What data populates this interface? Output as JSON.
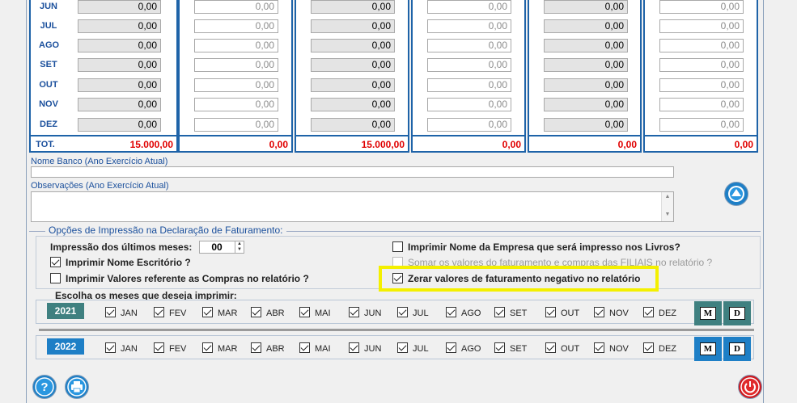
{
  "months": [
    "JUN",
    "JUL",
    "AGO",
    "SET",
    "OUT",
    "NOV",
    "DEZ"
  ],
  "total_label": "TOT.",
  "columns": [
    {
      "values": [
        "0,00",
        "0,00",
        "0,00",
        "0,00",
        "0,00",
        "0,00",
        "0,00"
      ],
      "total": "15.000,00"
    },
    {
      "values": [
        "0,00",
        "0,00",
        "0,00",
        "0,00",
        "0,00",
        "0,00",
        "0,00"
      ],
      "total": "0,00"
    },
    {
      "values": [
        "0,00",
        "0,00",
        "0,00",
        "0,00",
        "0,00",
        "0,00",
        "0,00"
      ],
      "total": "15.000,00"
    },
    {
      "values": [
        "0,00",
        "0,00",
        "0,00",
        "0,00",
        "0,00",
        "0,00",
        "0,00"
      ],
      "total": "0,00"
    },
    {
      "values": [
        "0,00",
        "0,00",
        "0,00",
        "0,00",
        "0,00",
        "0,00",
        "0,00"
      ],
      "total": "0,00"
    },
    {
      "values": [
        "0,00",
        "0,00",
        "0,00",
        "0,00",
        "0,00",
        "0,00",
        "0,00"
      ],
      "total": "0,00"
    }
  ],
  "nome_banco_label": "Nome Banco (Ano Exercício Atual)",
  "nome_banco_value": "",
  "observacoes_label": "Observações (Ano Exercício Atual)",
  "observacoes_value": "",
  "print_options": {
    "title": "Opções de Impressão na Declaração de Faturamento:",
    "ultimos_meses_label": "Impressão dos últimos meses:",
    "ultimos_meses_value": "00",
    "nome_escritorio": {
      "label": "Imprimir Nome Escritório ?",
      "checked": true
    },
    "valores_compras": {
      "label": "Imprimir Valores referente as Compras no relatório ?",
      "checked": false
    },
    "nome_empresa": {
      "label": "Imprimir Nome da Empresa que será impresso nos Livros?",
      "checked": false
    },
    "somar_filiais": {
      "label": "Somar os valores do faturamento e compras das FILIAIS no relatório ?",
      "checked": false
    },
    "zerar_negativo": {
      "label": "Zerar valores de faturamento negativo no relatório",
      "checked": true
    }
  },
  "months_section": {
    "title": "Escolha os meses que deseja imprimir:",
    "month_names": [
      "JAN",
      "FEV",
      "MAR",
      "ABR",
      "MAI",
      "JUN",
      "JUL",
      "AGO",
      "SET",
      "OUT",
      "NOV",
      "DEZ"
    ],
    "years": [
      {
        "year": "2021",
        "color": "#3f8080"
      },
      {
        "year": "2022",
        "color": "#1e7fc6"
      }
    ],
    "m_button": "M",
    "d_button": "D"
  },
  "colors": {
    "accent": "#1e63a8",
    "total_red": "#e00000",
    "highlight": "#f4f000",
    "help": "#1e7fc6",
    "power": "#d0181e"
  }
}
